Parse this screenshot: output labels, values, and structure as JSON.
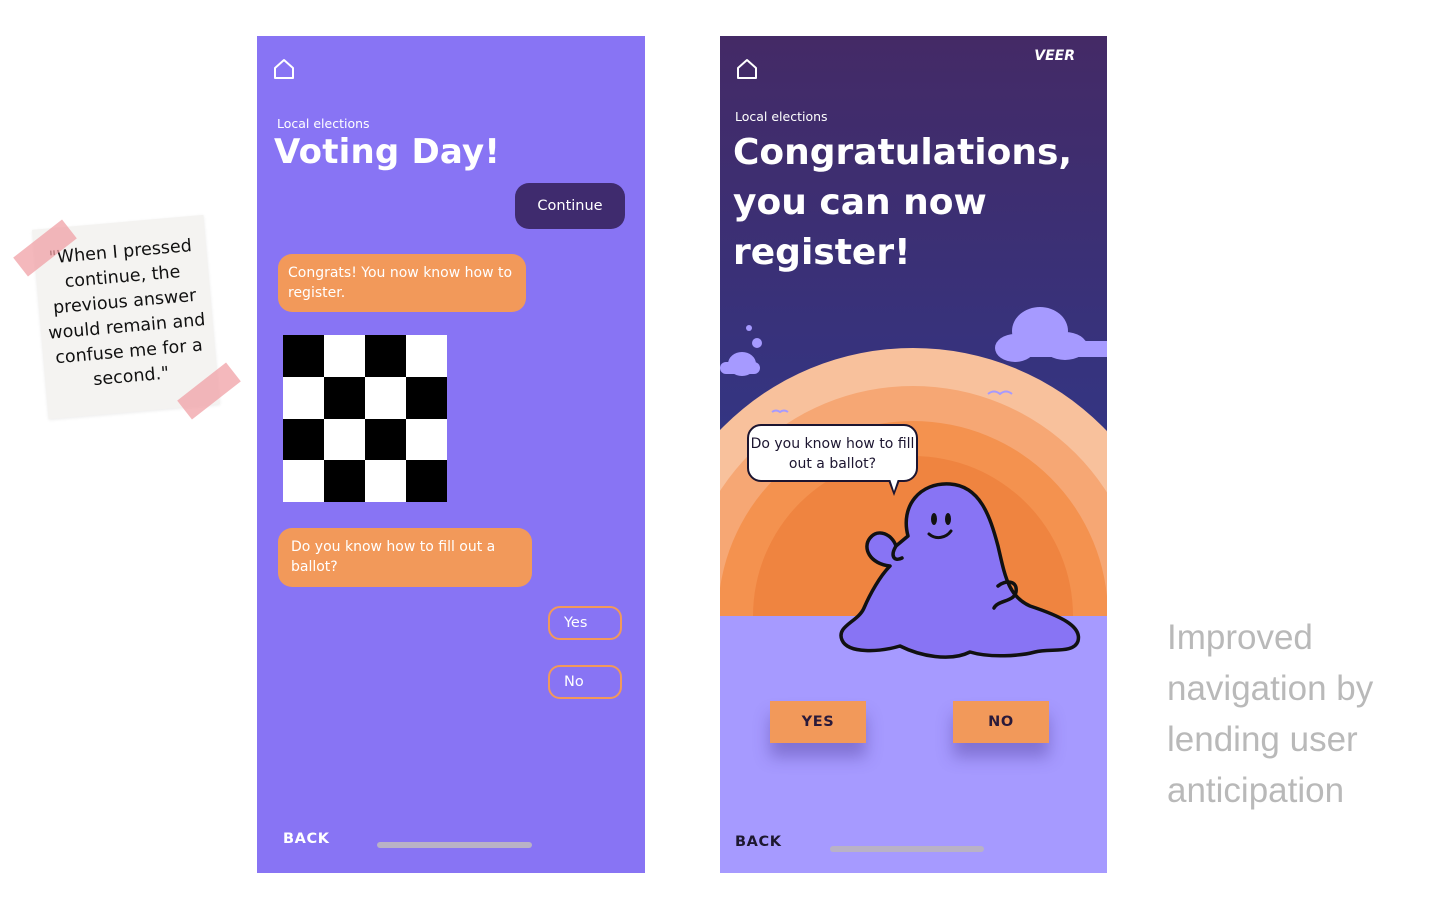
{
  "note": {
    "quote": "\"When I pressed continue, the previous answer would remain and confuse me for a second.\""
  },
  "screen_before": {
    "eyebrow": "Local elections",
    "title": "Voting Day!",
    "continue_label": "Continue",
    "message_1": "Congrats! You now know how to register.",
    "message_2": "Do you know how to fill out a ballot?",
    "yes_label": "Yes",
    "no_label": "No",
    "back_label": "BACK"
  },
  "screen_after": {
    "brand": "VEER",
    "eyebrow": "Local elections",
    "title": "Congratulations, you can now register!",
    "speech": "Do you know how to fill out a ballot?",
    "yes_label": "YES",
    "no_label": "NO",
    "back_label": "BACK"
  },
  "caption": "Improved navigation by lending user anticipation",
  "colors": {
    "phone_bg": "#8874f4",
    "accent_orange": "#f2995a",
    "dark_purple": "#3f2b6e",
    "caption_gray": "#b9b9b9"
  }
}
